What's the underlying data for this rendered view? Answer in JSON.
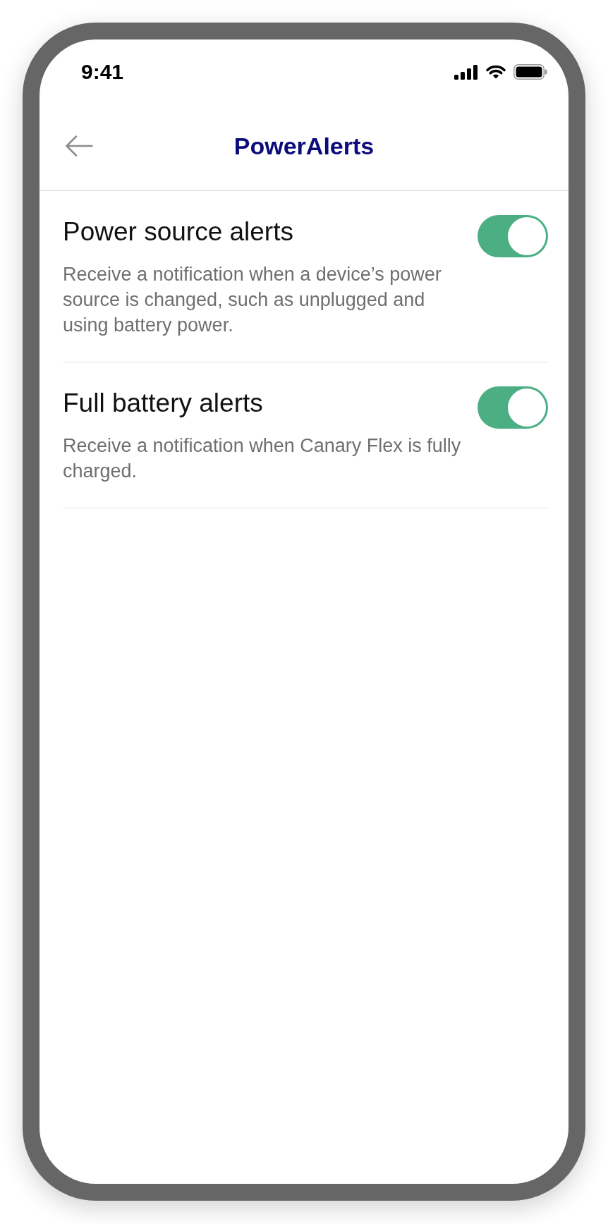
{
  "status_bar": {
    "time": "9:41"
  },
  "header": {
    "title": "PowerAlerts"
  },
  "settings": [
    {
      "title": "Power source alerts",
      "description": "Receive a notification when a device’s power source is changed, such as unplugged and using battery power.",
      "on": true
    },
    {
      "title": "Full battery alerts",
      "description": "Receive a notification when Canary Flex is fully charged.",
      "on": true
    }
  ]
}
